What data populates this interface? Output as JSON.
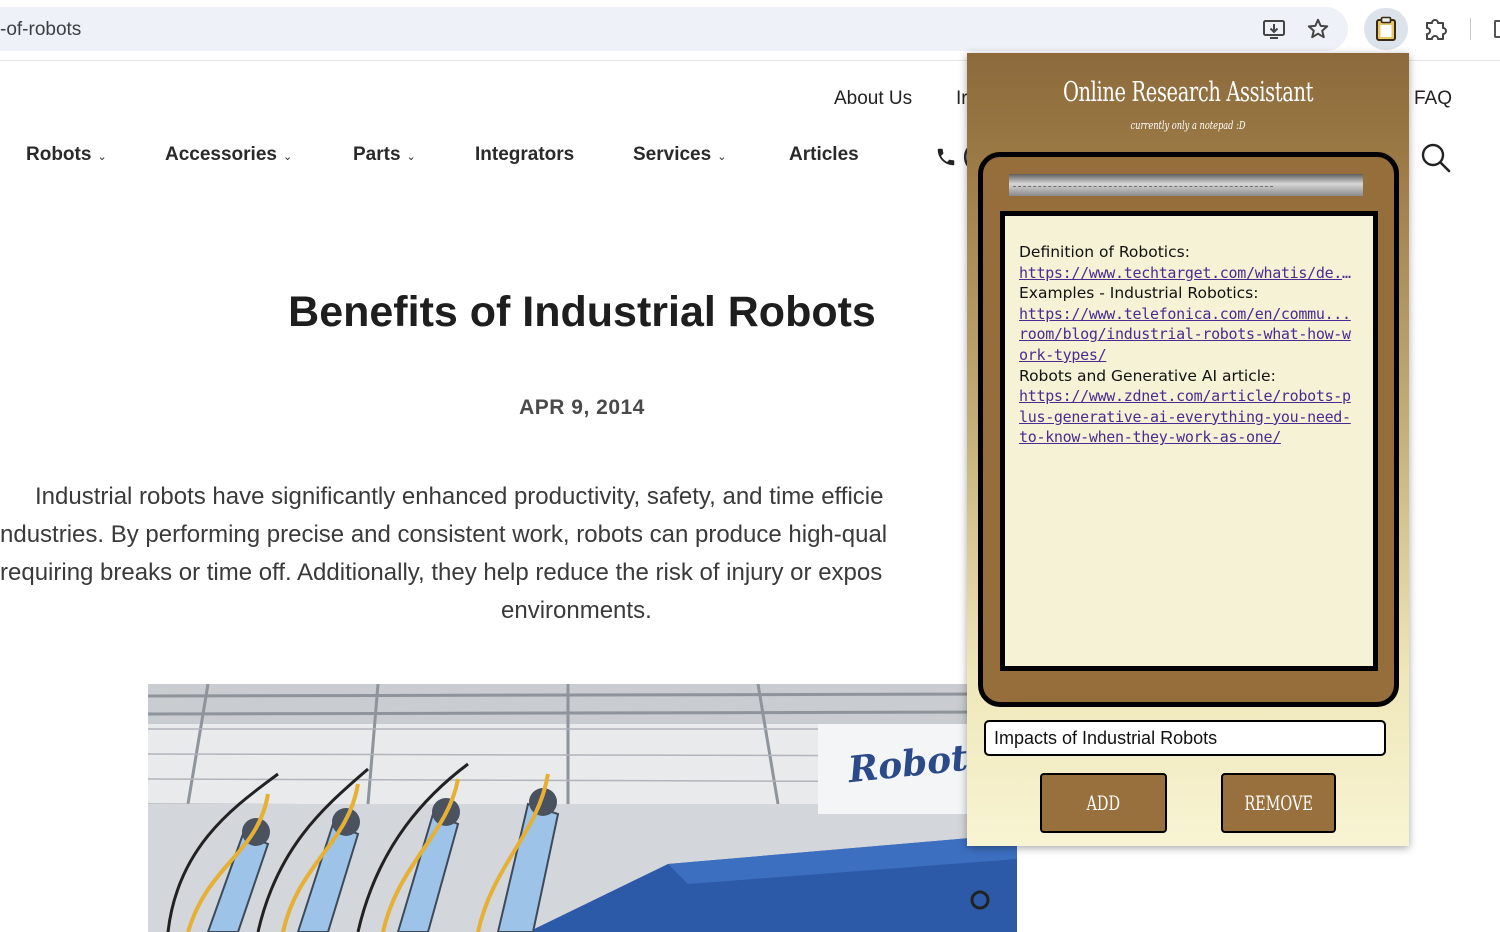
{
  "browser": {
    "url_fragment": "-of-robots",
    "icons": [
      "install-app-icon",
      "bookmark-star-icon",
      "clipboard-extension-icon",
      "puzzle-extensions-icon"
    ]
  },
  "site": {
    "top_nav": {
      "about": "About Us",
      "partial": "Ir",
      "faq": "FAQ"
    },
    "main_nav": [
      "Robots",
      "Accessories",
      "Parts",
      "Integrators",
      "Services",
      "Articles"
    ],
    "phone_partial": "(",
    "article": {
      "title": "Benefits of Industrial Robots",
      "date": "APR 9, 2014",
      "paragraph_lines": [
        "Industrial robots have significantly enhanced productivity, safety, and time efficie",
        "ndustries. By performing precise and consistent work, robots can produce high-qual",
        "requiring breaks or time off. Additionally, they help reduce the risk of injury or expos",
        "environments."
      ],
      "image_logo_text": "RobotWorx"
    }
  },
  "popup": {
    "title": "Online Research Assistant",
    "subtitle": "currently only a notepad :D",
    "notes": {
      "line1": "Definition of Robotics:",
      "link1": "https://www.techtarget.com/whatis/de...",
      "line2": "Examples - Industrial Robotics:",
      "link2": "https://www.telefonica.com/en/commu... room/blog/industrial-robots-what-how-work-types/",
      "line3": "Robots and Generative AI article:",
      "link3": "https://www.zdnet.com/article/robots-plus-generative-ai-everything-you-need-to-know-when-they-work-as-one/"
    },
    "input_value": "Impacts of Industrial Robots",
    "add_label": "ADD",
    "remove_label": "REMOVE"
  },
  "colors": {
    "popup_brown": "#956e3c",
    "paper": "#f6f2d5",
    "link": "#4b2b91"
  }
}
